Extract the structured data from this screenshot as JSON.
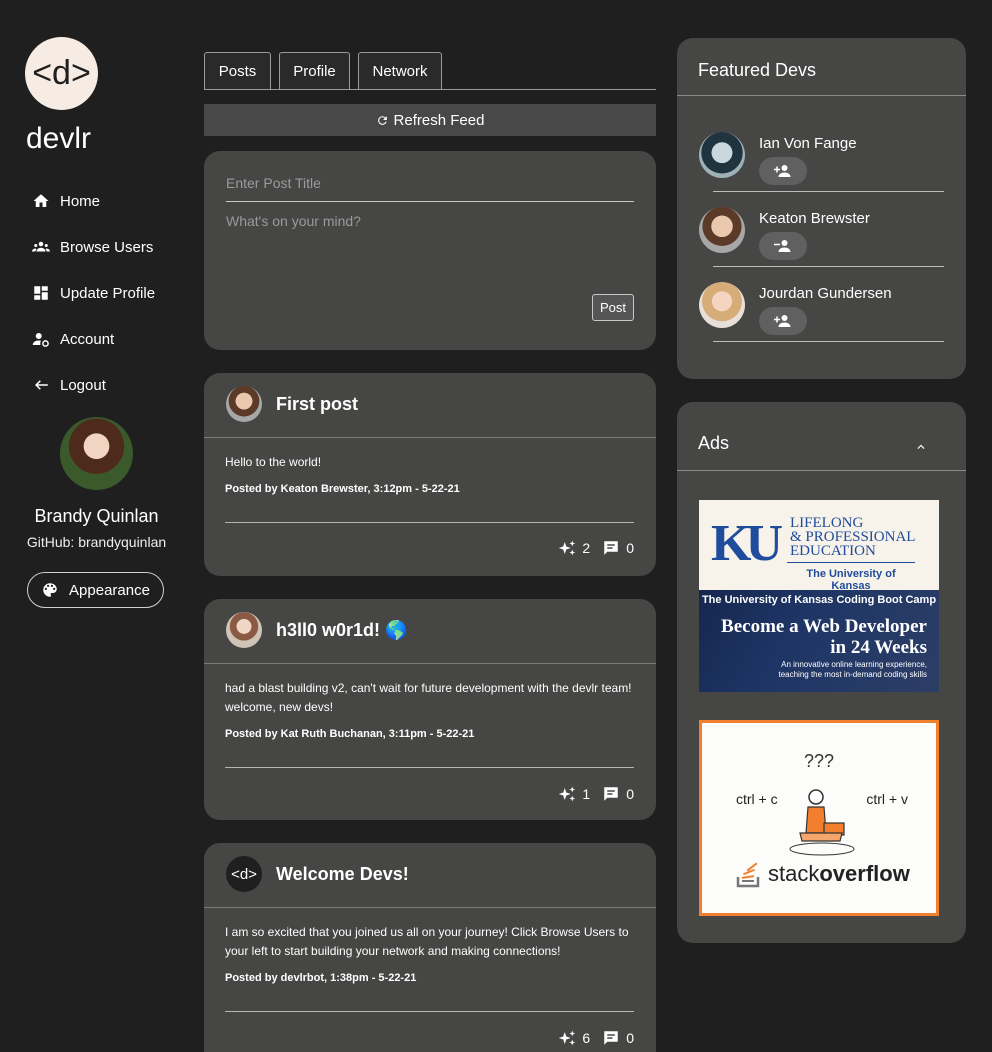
{
  "app": {
    "logo_text": "<d>",
    "brand": "devlr"
  },
  "sidebar": {
    "items": [
      {
        "label": "Home",
        "icon": "home-icon"
      },
      {
        "label": "Browse Users",
        "icon": "users-icon"
      },
      {
        "label": "Update Profile",
        "icon": "dashboard-icon"
      },
      {
        "label": "Account",
        "icon": "account-settings-icon"
      },
      {
        "label": "Logout",
        "icon": "logout-arrow-icon"
      }
    ],
    "user": {
      "name": "Brandy Quinlan",
      "github": "GitHub: brandyquinlan"
    },
    "appearance_label": "Appearance"
  },
  "main": {
    "tabs": [
      {
        "label": "Posts"
      },
      {
        "label": "Profile"
      },
      {
        "label": "Network"
      }
    ],
    "refresh_label": "Refresh Feed",
    "composer": {
      "title_placeholder": "Enter Post Title",
      "body_placeholder": "What's on your mind?",
      "post_label": "Post"
    },
    "posts": [
      {
        "title": "First post",
        "body": "Hello to the world!",
        "meta": "Posted by Keaton Brewster, 3:12pm - 5-22-21",
        "likes": "2",
        "comments": "0"
      },
      {
        "title": "h3ll0 w0r1d! 🌎",
        "body": "had a blast building v2, can't wait for future development with the devlr team! welcome, new devs!",
        "meta": "Posted by Kat Ruth Buchanan, 3:11pm - 5-22-21",
        "likes": "1",
        "comments": "0"
      },
      {
        "title": "Welcome Devs!",
        "body": "I am so excited that you joined us all on your journey! Click Browse Users to your left to start building your network and making connections!",
        "meta": "Posted by devlrbot, 1:38pm - 5-22-21",
        "likes": "6",
        "comments": "0",
        "avatar_text": "<d>"
      }
    ]
  },
  "right": {
    "featured": {
      "title": "Featured Devs",
      "devs": [
        {
          "name": "Ian Von Fange",
          "action": "add-person-icon"
        },
        {
          "name": "Keaton Brewster",
          "action": "remove-person-icon"
        },
        {
          "name": "Jourdan Gundersen",
          "action": "add-person-icon"
        }
      ]
    },
    "ads": {
      "title": "Ads",
      "ku": {
        "logo": "KU",
        "line1": "LIFELONG",
        "line2": "& PROFESSIONAL",
        "line3": "EDUCATION",
        "university": "The University of Kansas",
        "bootcamp": "The University of Kansas Coding Boot Camp",
        "headline1": "Become a Web Developer",
        "headline2": "in 24 Weeks",
        "sub1": "An innovative online learning experience,",
        "sub2": "teaching the most in-demand coding skills"
      },
      "so": {
        "question": "???",
        "copy": "ctrl + c",
        "paste": "ctrl + v",
        "brand_light": "stack",
        "brand_bold": "overflow"
      }
    }
  },
  "colors": {
    "background": "#1f1f1f",
    "card": "#464645",
    "accent_orange": "#f17f2e",
    "ku_blue": "#1f4c9b"
  }
}
